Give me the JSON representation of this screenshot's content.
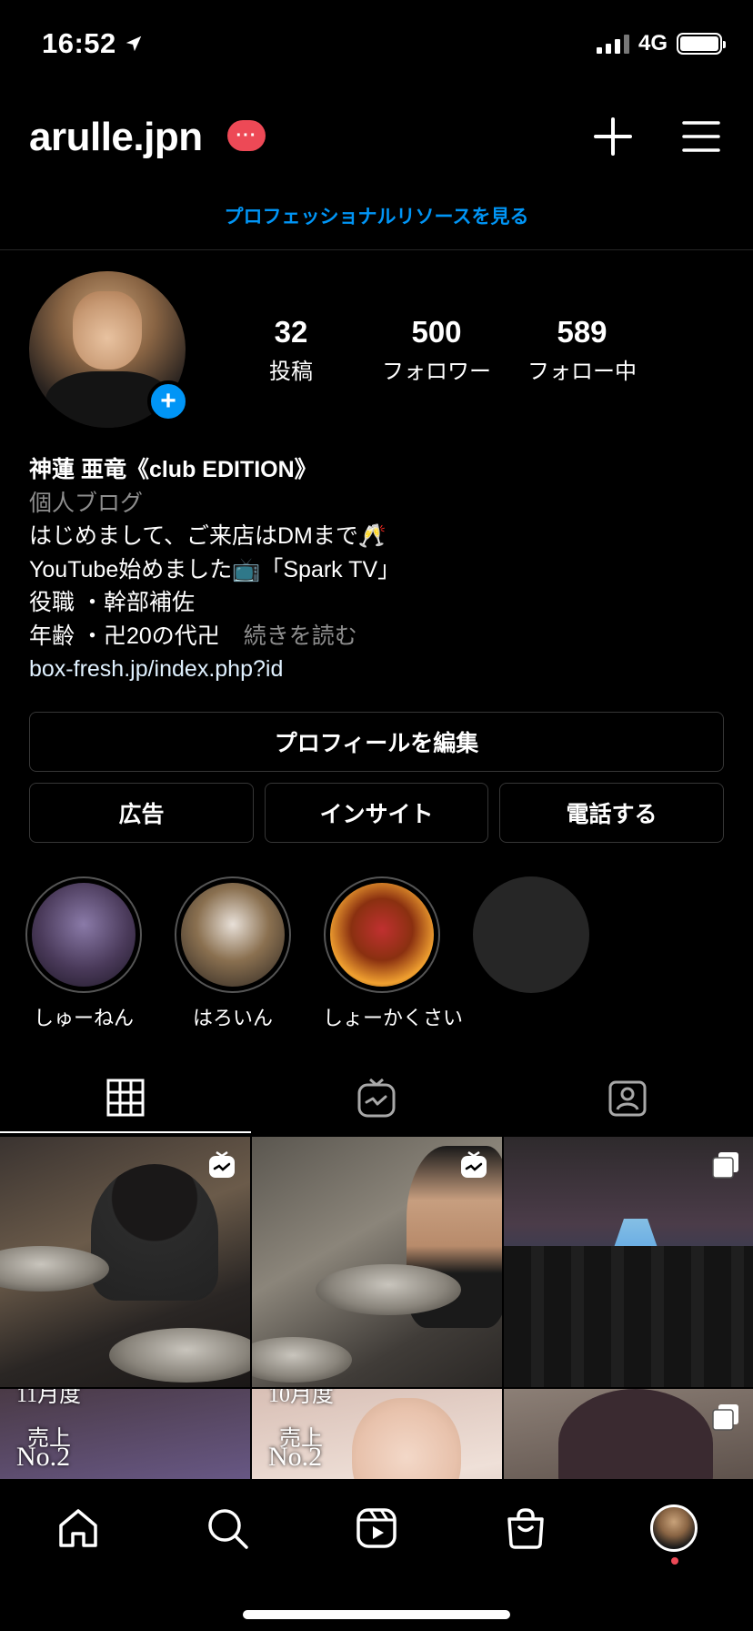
{
  "status_bar": {
    "time": "16:52",
    "network": "4G"
  },
  "header": {
    "username": "arulle.jpn",
    "badge": "···"
  },
  "resources_link": "プロフェッショナルリソースを見る",
  "stats": [
    {
      "value": "32",
      "label": "投稿"
    },
    {
      "value": "500",
      "label": "フォロワー"
    },
    {
      "value": "589",
      "label": "フォロー中"
    }
  ],
  "bio": {
    "name": "神蓮 亜竜《club EDITION》",
    "category": "個人ブログ",
    "line1": "はじめまして、ご来店はDMまで🥂",
    "line2": "YouTube始めました📺「Spark TV」",
    "line3": "役職 ・幹部補佐",
    "line4": "年齢 ・卍20の代卍",
    "more": "続きを読む",
    "link": "box-fresh.jp/index.php?id"
  },
  "buttons": {
    "edit_profile": "プロフィールを編集",
    "ads": "広告",
    "insights": "インサイト",
    "call": "電話する"
  },
  "highlights": [
    {
      "label": "しゅーねん",
      "color": "#4a3a5a"
    },
    {
      "label": "はろいん",
      "color": "#5a4a3a"
    },
    {
      "label": "しょーかくさい",
      "color": "#6a2a1a"
    }
  ],
  "grid_posts": [
    {
      "type": "igtv"
    },
    {
      "type": "igtv"
    },
    {
      "type": "carousel"
    },
    {
      "type": "image",
      "top_text": "11月度",
      "mid_text": "売上",
      "big_text": "No.2"
    },
    {
      "type": "image",
      "top_text": "10月度",
      "mid_text": "売上",
      "big_text": "No.2"
    },
    {
      "type": "carousel"
    }
  ],
  "colors": {
    "accent": "#0095f6",
    "badge": "#ed4956",
    "background": "#000000"
  }
}
